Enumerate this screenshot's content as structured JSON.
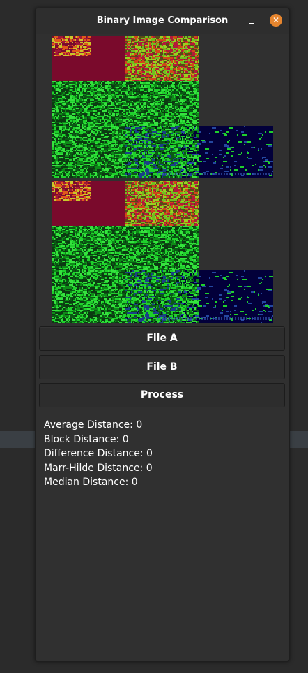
{
  "window": {
    "title": "Binary Image Comparison",
    "close_glyph": "✕"
  },
  "colors": {
    "background": "#2b2b2b",
    "window": "#303030",
    "close_button": "#e6852e",
    "image_red": "#7a0a2c",
    "image_green": "#1fd12c",
    "image_navy": "#02003a"
  },
  "icons": {
    "minimize": "minimize-icon",
    "close": "close-icon"
  },
  "buttons": {
    "file_a": "File A",
    "file_b": "File B",
    "process": "Process"
  },
  "results": [
    "Average Distance: 0",
    "Block Distance: 0",
    "Difference Distance: 0",
    "Marr-Hilde Distance: 0",
    "Median Distance: 0"
  ]
}
